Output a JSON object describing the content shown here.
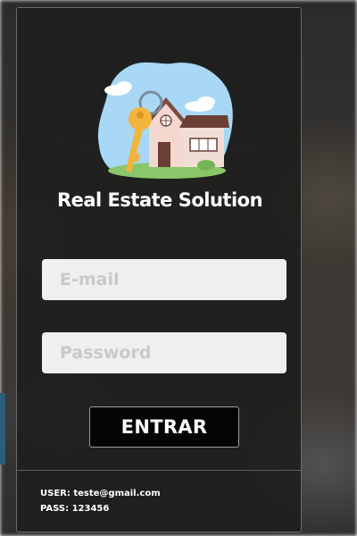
{
  "app": {
    "title": "Real Estate Solution",
    "logo_icon": "house-with-key-logo"
  },
  "form": {
    "email_placeholder": "E-mail",
    "email_value": "",
    "password_placeholder": "Password",
    "password_value": "",
    "submit_label": "ENTRAR"
  },
  "credentials": {
    "user_line": "USER: teste@gmail.com",
    "pass_line": "PASS: 123456"
  },
  "colors": {
    "card_background": "#1e1e1e",
    "input_background": "#efefef",
    "button_background": "#050505",
    "text": "#ffffff",
    "logo_sky": "#a8d8f5",
    "logo_grass": "#8cc66a",
    "logo_key": "#f2b53c"
  }
}
